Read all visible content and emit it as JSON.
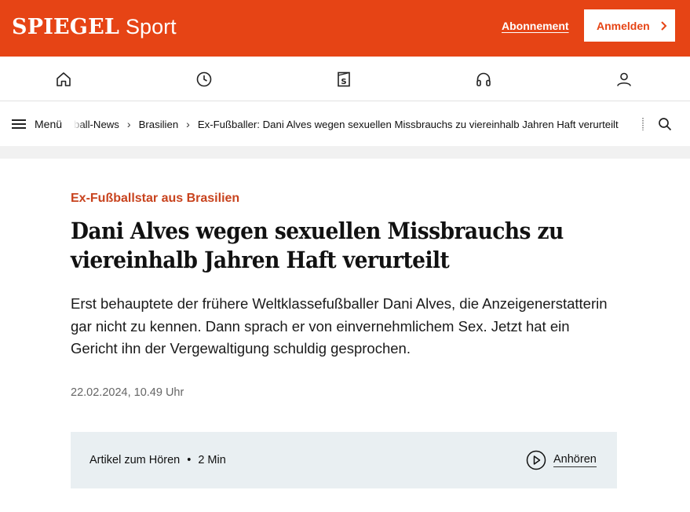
{
  "header": {
    "brand_name": "SPIEGEL",
    "brand_section": "Sport",
    "subscription_label": "Abonnement",
    "login_label": "Anmelden",
    "accent_color": "#e64415"
  },
  "icon_nav": {
    "items": [
      {
        "icon": "home-icon"
      },
      {
        "icon": "clock-icon"
      },
      {
        "icon": "spiegel-plus-icon",
        "glyph": "S"
      },
      {
        "icon": "headphones-icon"
      },
      {
        "icon": "user-icon"
      }
    ]
  },
  "breadcrumb_bar": {
    "menu_label": "Menü",
    "items": [
      "ball-News",
      "Brasilien",
      "Ex-Fußballer: Dani Alves wegen sexuellen Missbrauchs zu viereinhalb Jahren Haft verurteilt"
    ],
    "search_icon": "search-icon"
  },
  "article": {
    "kicker": "Ex-Fußballstar aus Brasilien",
    "headline": "Dani Alves wegen sexuellen Missbrauchs zu viereinhalb Jahren Haft verurteilt",
    "teaser": "Erst behauptete der frühere Weltklassefußballer Dani Alves, die Anzeigenerstatterin gar nicht zu kennen. Dann sprach er von einvernehmlichem Sex. Jetzt hat ein Gericht ihn der Vergewaltigung schuldig gesprochen.",
    "date": "22.02.2024, 10.49 Uhr"
  },
  "audio": {
    "label": "Artikel zum Hören",
    "separator": "•",
    "duration": "2 Min",
    "listen_label": "Anhören"
  }
}
